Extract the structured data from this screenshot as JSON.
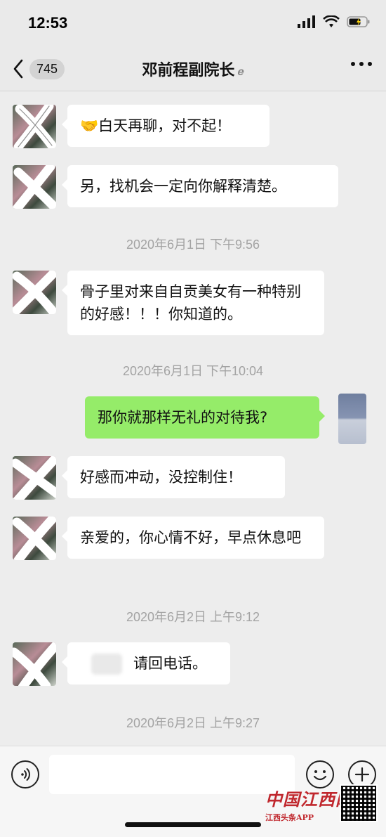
{
  "status_bar": {
    "time": "12:53"
  },
  "nav": {
    "back_count": "745",
    "title": "邓前程副院长"
  },
  "messages": [
    {
      "side": "left",
      "text": "🤝白天再聊，对不起！"
    },
    {
      "side": "left",
      "text": "另，找机会一定向你解释清楚。"
    },
    {
      "type": "time",
      "text": "2020年6月1日 下午9:56"
    },
    {
      "side": "left",
      "text": "骨子里对来自自贡美女有一种特别的好感！！！你知道的。"
    },
    {
      "type": "time",
      "text": "2020年6月1日 下午10:04"
    },
    {
      "side": "right",
      "text": "那你就那样无礼的对待我?"
    },
    {
      "side": "left",
      "text": "好感而冲动，没控制住！"
    },
    {
      "side": "left",
      "text": "亲爱的，你心情不好，早点休息吧"
    },
    {
      "type": "time",
      "text": "2020年6月2日 上午9:12"
    },
    {
      "side": "left",
      "text": "请回电话。"
    },
    {
      "type": "time",
      "text": "2020年6月2日 上午9:27"
    }
  ],
  "watermark": {
    "line1": "中国江西网",
    "line2": "江西头条APP"
  },
  "colors": {
    "sent_bubble": "#95ec69",
    "received_bubble": "#ffffff",
    "background": "#ededed"
  },
  "icons": [
    "signal-icon",
    "wifi-icon",
    "battery-icon",
    "back-chevron-icon",
    "ear-icon",
    "more-icon",
    "voice-icon",
    "emoji-icon",
    "plus-icon"
  ]
}
